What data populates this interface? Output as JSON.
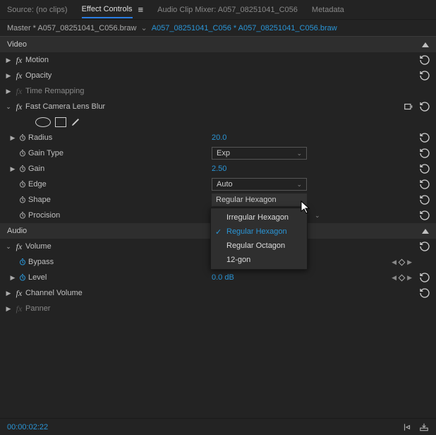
{
  "tabs": {
    "source": "Source: (no clips)",
    "effect_controls": "Effect Controls",
    "audio_mixer": "Audio Clip Mixer: A057_08251041_C056",
    "metadata": "Metadata"
  },
  "clip": {
    "master": "Master * A057_08251041_C056.braw",
    "sequence": "A057_08251041_C056 * A057_08251041_C056.braw"
  },
  "sections": {
    "video": "Video",
    "audio": "Audio"
  },
  "effects": {
    "motion": "Motion",
    "opacity": "Opacity",
    "time_remapping": "Time Remapping",
    "fclb": "Fast Camera Lens Blur",
    "volume": "Volume",
    "channel_volume": "Channel Volume",
    "panner": "Panner"
  },
  "params": {
    "radius": {
      "label": "Radius",
      "value": "20.0"
    },
    "gain_type": {
      "label": "Gain Type",
      "value": "Exp"
    },
    "gain": {
      "label": "Gain",
      "value": "2.50"
    },
    "edge": {
      "label": "Edge",
      "value": "Auto"
    },
    "shape": {
      "label": "Shape",
      "value": "Regular Hexagon"
    },
    "procision": {
      "label": "Procision",
      "value": ""
    },
    "bypass": {
      "label": "Bypass"
    },
    "level": {
      "label": "Level",
      "value": "0.0 dB"
    }
  },
  "shape_menu": {
    "irregular_hexagon": "Irregular Hexagon",
    "regular_hexagon": "Regular Hexagon",
    "regular_octagon": "Regular Octagon",
    "twelve_gon": "12-gon"
  },
  "footer": {
    "timecode": "00:00:02:22"
  }
}
